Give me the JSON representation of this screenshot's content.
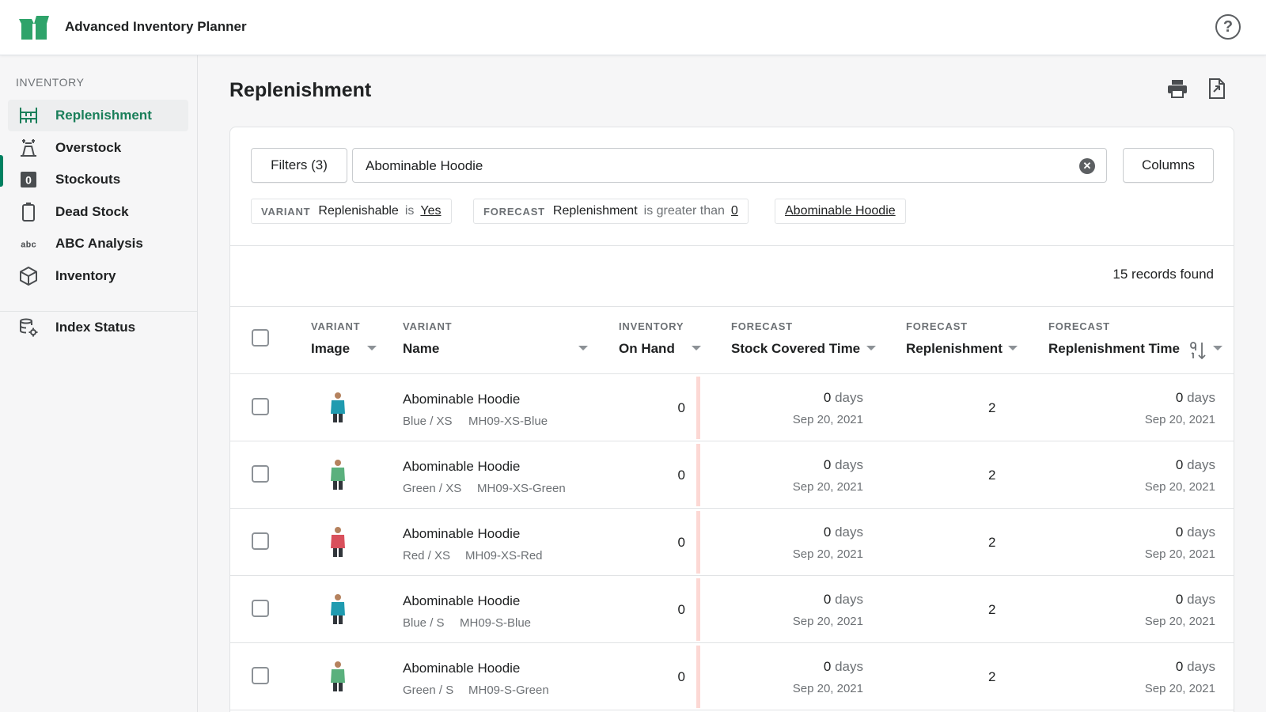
{
  "app": {
    "title": "Advanced Inventory Planner"
  },
  "sidebar": {
    "section": "INVENTORY",
    "items": [
      {
        "label": "Replenishment",
        "icon": "replenishment-icon",
        "active": true
      },
      {
        "label": "Overstock",
        "icon": "overstock-icon"
      },
      {
        "label": "Stockouts",
        "icon": "stockouts-icon"
      },
      {
        "label": "Dead Stock",
        "icon": "dead-stock-icon"
      },
      {
        "label": "ABC Analysis",
        "icon": "abc-icon"
      },
      {
        "label": "Inventory",
        "icon": "inventory-box-icon"
      }
    ],
    "secondary": [
      {
        "label": "Index Status",
        "icon": "database-gear-icon"
      }
    ]
  },
  "page": {
    "title": "Replenishment",
    "actions": [
      "print-icon",
      "export-icon"
    ]
  },
  "filters": {
    "button_label": "Filters (3)",
    "search_value": "Abominable Hoodie",
    "columns_label": "Columns",
    "chips": [
      {
        "category": "VARIANT",
        "field": "Replenishable",
        "operator": "is",
        "value": "Yes"
      },
      {
        "category": "FORECAST",
        "field": "Replenishment",
        "operator": "is greater than",
        "value": "0"
      },
      {
        "category": "",
        "field": "",
        "operator": "",
        "value": "Abominable Hoodie"
      }
    ]
  },
  "records_found": "15 records found",
  "table": {
    "columns": [
      {
        "category": "VARIANT",
        "name": "Image"
      },
      {
        "category": "VARIANT",
        "name": "Name"
      },
      {
        "category": "INVENTORY",
        "name": "On Hand"
      },
      {
        "category": "FORECAST",
        "name": "Stock Covered Time"
      },
      {
        "category": "FORECAST",
        "name": "Replenishment"
      },
      {
        "category": "FORECAST",
        "name": "Replenishment Time"
      }
    ],
    "rows": [
      {
        "name": "Abominable Hoodie",
        "variant": "Blue / XS",
        "sku": "MH09-XS-Blue",
        "on_hand": "0",
        "stock_days": "0",
        "stock_unit": "days",
        "stock_date": "Sep 20, 2021",
        "replenishment": "2",
        "repl_days": "0",
        "repl_unit": "days",
        "repl_date": "Sep 20, 2021",
        "color": "#1f9bb0"
      },
      {
        "name": "Abominable Hoodie",
        "variant": "Green / XS",
        "sku": "MH09-XS-Green",
        "on_hand": "0",
        "stock_days": "0",
        "stock_unit": "days",
        "stock_date": "Sep 20, 2021",
        "replenishment": "2",
        "repl_days": "0",
        "repl_unit": "days",
        "repl_date": "Sep 20, 2021",
        "color": "#5ab07d"
      },
      {
        "name": "Abominable Hoodie",
        "variant": "Red / XS",
        "sku": "MH09-XS-Red",
        "on_hand": "0",
        "stock_days": "0",
        "stock_unit": "days",
        "stock_date": "Sep 20, 2021",
        "replenishment": "2",
        "repl_days": "0",
        "repl_unit": "days",
        "repl_date": "Sep 20, 2021",
        "color": "#d9505c"
      },
      {
        "name": "Abominable Hoodie",
        "variant": "Blue / S",
        "sku": "MH09-S-Blue",
        "on_hand": "0",
        "stock_days": "0",
        "stock_unit": "days",
        "stock_date": "Sep 20, 2021",
        "replenishment": "2",
        "repl_days": "0",
        "repl_unit": "days",
        "repl_date": "Sep 20, 2021",
        "color": "#1f9bb0"
      },
      {
        "name": "Abominable Hoodie",
        "variant": "Green / S",
        "sku": "MH09-S-Green",
        "on_hand": "0",
        "stock_days": "0",
        "stock_unit": "days",
        "stock_date": "Sep 20, 2021",
        "replenishment": "2",
        "repl_days": "0",
        "repl_unit": "days",
        "repl_date": "Sep 20, 2021",
        "color": "#5ab07d"
      }
    ]
  },
  "colors": {
    "accent": "#008060",
    "active_text": "#1a7f5a",
    "alert_bar": "#fcd8d4"
  }
}
